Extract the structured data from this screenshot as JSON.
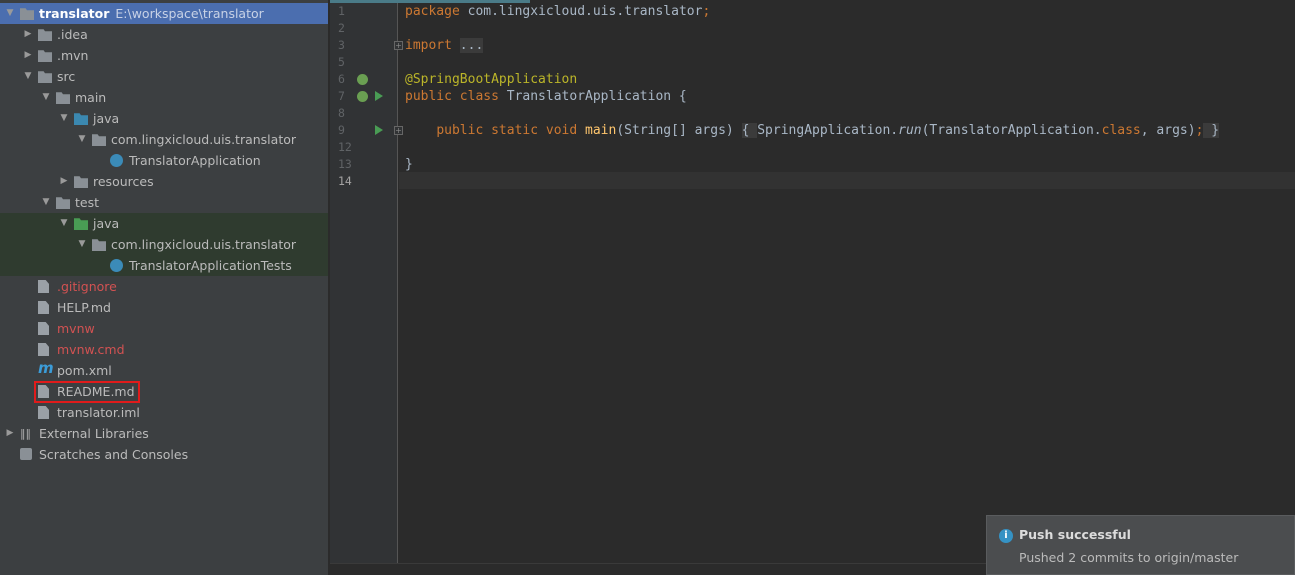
{
  "project_tree": {
    "root": {
      "name": "translator",
      "path": "E:\\workspace\\translator"
    },
    "items": [
      {
        "label": ".idea",
        "depth": 1,
        "arrow": "right",
        "icon": "folder-icon"
      },
      {
        "label": ".mvn",
        "depth": 1,
        "arrow": "right",
        "icon": "folder-icon"
      },
      {
        "label": "src",
        "depth": 1,
        "arrow": "down",
        "icon": "folder-icon"
      },
      {
        "label": "main",
        "depth": 2,
        "arrow": "down",
        "icon": "folder-icon"
      },
      {
        "label": "java",
        "depth": 3,
        "arrow": "down",
        "icon": "source-folder-icon"
      },
      {
        "label": "com.lingxicloud.uis.translator",
        "depth": 4,
        "arrow": "down",
        "icon": "package-icon"
      },
      {
        "label": "TranslatorApplication",
        "depth": 5,
        "arrow": "",
        "icon": "spring-class-icon"
      },
      {
        "label": "resources",
        "depth": 3,
        "arrow": "right",
        "icon": "resources-folder-icon"
      },
      {
        "label": "test",
        "depth": 2,
        "arrow": "down",
        "icon": "folder-icon"
      },
      {
        "label": "java",
        "depth": 3,
        "arrow": "down",
        "icon": "test-folder-icon",
        "test": true
      },
      {
        "label": "com.lingxicloud.uis.translator",
        "depth": 4,
        "arrow": "down",
        "icon": "package-icon",
        "test": true
      },
      {
        "label": "TranslatorApplicationTests",
        "depth": 5,
        "arrow": "",
        "icon": "test-class-icon",
        "test": true
      },
      {
        "label": ".gitignore",
        "depth": 1,
        "arrow": "",
        "icon": "file-icon",
        "status": "untracked"
      },
      {
        "label": "HELP.md",
        "depth": 1,
        "arrow": "",
        "icon": "markdown-file-icon"
      },
      {
        "label": "mvnw",
        "depth": 1,
        "arrow": "",
        "icon": "file-icon",
        "status": "untracked"
      },
      {
        "label": "mvnw.cmd",
        "depth": 1,
        "arrow": "",
        "icon": "file-icon",
        "status": "untracked"
      },
      {
        "label": "pom.xml",
        "depth": 1,
        "arrow": "",
        "icon": "maven-icon"
      },
      {
        "label": "README.md",
        "depth": 1,
        "arrow": "",
        "icon": "markdown-file-icon",
        "highlighted": true
      },
      {
        "label": "translator.iml",
        "depth": 1,
        "arrow": "",
        "icon": "module-file-icon"
      },
      {
        "label": "External Libraries",
        "depth": 0,
        "arrow": "right",
        "icon": "libraries-icon"
      },
      {
        "label": "Scratches and Consoles",
        "depth": 0,
        "arrow": "",
        "icon": "scratches-icon"
      }
    ]
  },
  "editor": {
    "current_line": "14",
    "lines": [
      {
        "n": "1",
        "html": "<span class='kw'>package</span> com.lingxicloud.uis.translator<span class='kw'>;</span>"
      },
      {
        "n": "2",
        "html": ""
      },
      {
        "n": "3",
        "html": "<span class='kw'>import</span> <span class='fold'>...</span>",
        "fold": true
      },
      {
        "n": "5",
        "html": ""
      },
      {
        "n": "6",
        "html": "<span class='ann'>@SpringBootApplication</span>",
        "bean": true
      },
      {
        "n": "7",
        "html": "<span class='kw'>public class</span> TranslatorApplication {",
        "bean": true,
        "run": true
      },
      {
        "n": "8",
        "html": ""
      },
      {
        "n": "9",
        "html": "    <span class='kw'>public static void</span> <span class='fn'>main</span>(String[] args) <span class='fold'>{ </span>SpringApplication.<span class='it'>run</span>(TranslatorApplication.<span class='kw'>class</span>, args)<span class='kw'>;</span><span class='fold'> }</span>",
        "run": true,
        "fold": true
      },
      {
        "n": "12",
        "html": ""
      },
      {
        "n": "13",
        "html": "}"
      },
      {
        "n": "14",
        "html": ""
      }
    ]
  },
  "notification": {
    "title": "Push successful",
    "message": "Pushed 2 commits to origin/master",
    "icon": "info-icon"
  },
  "colors": {
    "selection": "#4b6eaf",
    "keyword": "#cc7832",
    "annotation": "#bbb529",
    "untracked": "#d25252",
    "highlight_box": "#e01b1b"
  }
}
